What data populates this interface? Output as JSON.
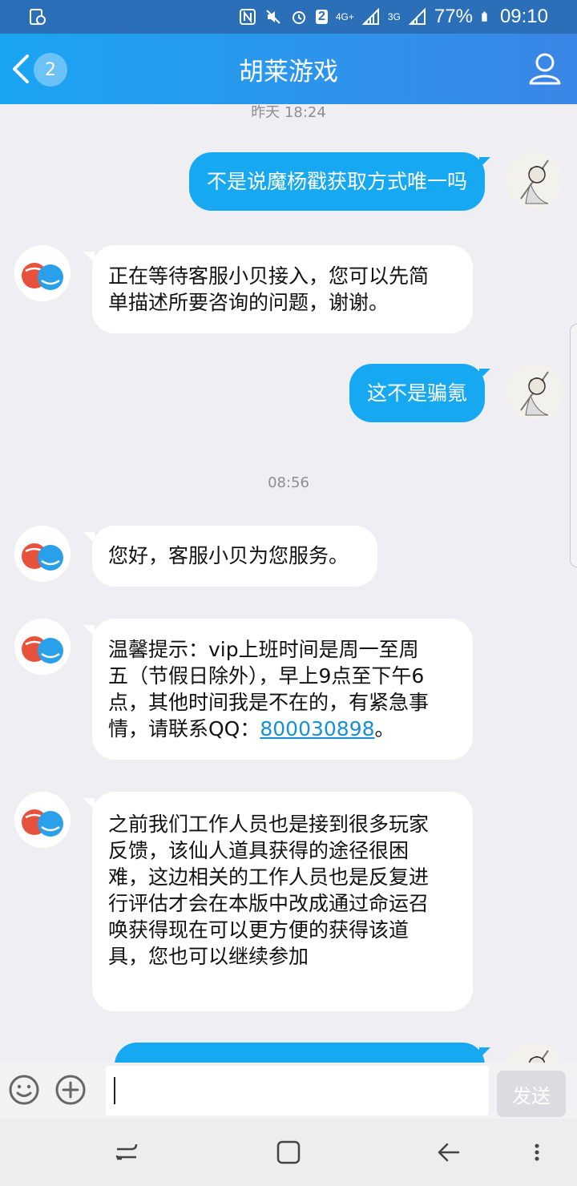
{
  "status_bar": {
    "network_4g": "4G+",
    "network_3g": "3G",
    "sim_badge": "2",
    "battery": "77%",
    "time": "09:10"
  },
  "header": {
    "back_badge": "2",
    "title": "胡莱游戏"
  },
  "chat": {
    "timestamps": [
      "昨天 18:24",
      "08:56"
    ],
    "messages": {
      "m1": "不是说魔杨戳获取方式唯一吗",
      "m2_line1": "正在等待客服小贝接入，您可以先简",
      "m2_line2": "单描述所要咨询的问题，谢谢。",
      "m3": "这不是骗氪",
      "m4": "您好，客服小贝为您服务。",
      "m5_line1": "温馨提示：vip上班时间是周一至周",
      "m5_line2": "五（节假日除外），早上9点至下午6",
      "m5_line3": "点，其他时间我是不在的，有紧急事",
      "m5_line4_prefix": "情，请联系QQ：",
      "m5_link": "800030898",
      "m5_line4_suffix": "。",
      "m6_line1": "之前我们工作人员也是接到很多玩家",
      "m6_line2": "反馈，该仙人道具获得的途径很困",
      "m6_line3": "难，这边相关的工作人员也是反复进",
      "m6_line4": "行评估才会在本版中改成通过命运召",
      "m6_line5": "唤获得现在可以更方便的获得该道",
      "m6_line6": "具，您也可以继续参加"
    }
  },
  "input_bar": {
    "send_label": "发送",
    "input_placeholder": ""
  },
  "icons": {
    "back": "chevron-left-icon",
    "profile": "person-icon",
    "emoji": "smiley-icon",
    "plus": "plus-circle-icon"
  },
  "colors": {
    "header_start": "#1aa5f2",
    "header_end": "#3b86e6",
    "outgoing_bubble": "#17a8f2",
    "link": "#1990d6"
  }
}
